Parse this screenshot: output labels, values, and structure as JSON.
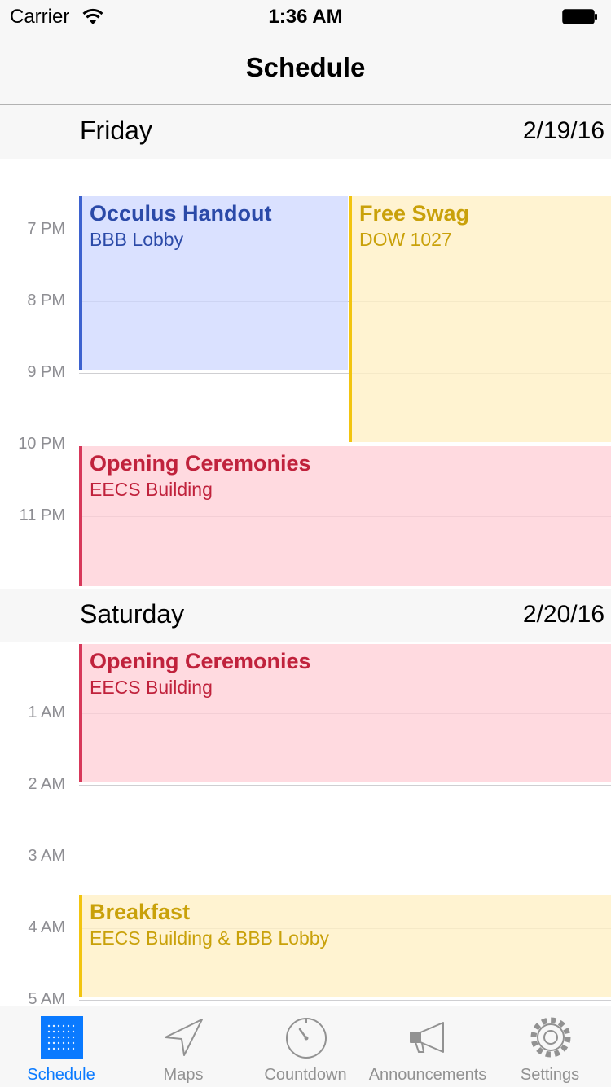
{
  "status_bar": {
    "carrier": "Carrier",
    "time": "1:36 AM"
  },
  "nav": {
    "title": "Schedule"
  },
  "days": [
    {
      "name": "Friday",
      "date": "2/19/16",
      "hours": [
        "7 PM",
        "8 PM",
        "9 PM",
        "10 PM",
        "11 PM"
      ],
      "events": [
        {
          "title": "Occulus Handout",
          "location": "BBB Lobby",
          "color": "blue"
        },
        {
          "title": "Free Swag",
          "location": "DOW 1027",
          "color": "yellow"
        },
        {
          "title": "Opening Ceremonies",
          "location": "EECS Building",
          "color": "red"
        }
      ]
    },
    {
      "name": "Saturday",
      "date": "2/20/16",
      "hours": [
        "1 AM",
        "2 AM",
        "3 AM",
        "4 AM",
        "5 AM"
      ],
      "events": [
        {
          "title": "Opening Ceremonies",
          "location": "EECS Building",
          "color": "red"
        },
        {
          "title": "Breakfast",
          "location": "EECS Building & BBB Lobby",
          "color": "yellow"
        }
      ]
    }
  ],
  "colors": {
    "accent": "#0a7aff",
    "blue": "#3d62cf",
    "yellow": "#f2c40f",
    "red": "#d7385a"
  },
  "tabs": [
    {
      "label": "Schedule",
      "icon": "calendar-grid-icon",
      "active": true
    },
    {
      "label": "Maps",
      "icon": "location-arrow-icon",
      "active": false
    },
    {
      "label": "Countdown",
      "icon": "stopwatch-icon",
      "active": false
    },
    {
      "label": "Announcements",
      "icon": "megaphone-icon",
      "active": false
    },
    {
      "label": "Settings",
      "icon": "gear-icon",
      "active": false
    }
  ]
}
